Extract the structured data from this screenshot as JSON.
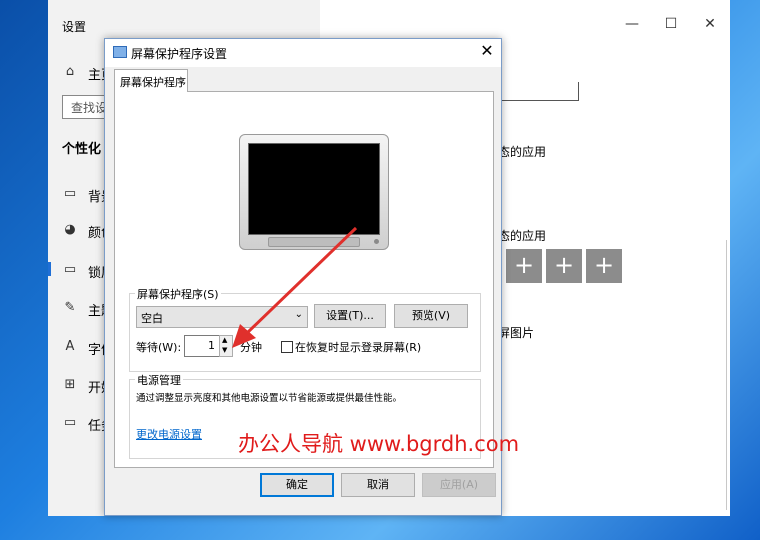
{
  "settings": {
    "title": "设置",
    "nav": [
      {
        "icon": "home-icon",
        "glyph": "⌂",
        "label": "主页"
      },
      {
        "icon": "picture-icon",
        "glyph": "▭",
        "label": "背景"
      },
      {
        "icon": "palette-icon",
        "glyph": "◕",
        "label": "颜色"
      },
      {
        "icon": "lock-screen-icon",
        "glyph": "▭",
        "label": "锁屏"
      },
      {
        "icon": "theme-brush-icon",
        "glyph": "✎",
        "label": "主题"
      },
      {
        "icon": "font-icon",
        "glyph": "A",
        "label": "字体"
      },
      {
        "icon": "start-icon",
        "glyph": "⊞",
        "label": "开始"
      },
      {
        "icon": "taskbar-icon",
        "glyph": "▭",
        "label": "任务栏"
      }
    ],
    "search_placeholder": "查找设",
    "section": "个性化",
    "right_text_1": "态的应用",
    "right_text_2": "态的应用",
    "right_text_3": "屏图片",
    "plus": "+",
    "window_controls": {
      "minimize": "—",
      "maximize": "☐",
      "close": "✕"
    }
  },
  "dialog": {
    "title": "屏幕保护程序设置",
    "close": "✕",
    "tab": "屏幕保护程序",
    "screensaver_group": "屏幕保护程序(S)",
    "screensaver_value": "空白",
    "settings_button": "设置(T)...",
    "preview_button": "预览(V)",
    "wait_label": "等待(W):",
    "wait_value": "1",
    "minutes": "分钟",
    "resume_label": "在恢复时显示登录屏幕(R)",
    "power_group": "电源管理",
    "power_text": "通过调整显示亮度和其他电源设置以节省能源或提供最佳性能。",
    "power_link": "更改电源设置",
    "ok": "确定",
    "cancel": "取消",
    "apply": "应用(A)"
  },
  "watermark": "办公人导航  www.bgrdh.com",
  "colors": {
    "arrow": "#e0302c",
    "accent": "#0078d7"
  }
}
